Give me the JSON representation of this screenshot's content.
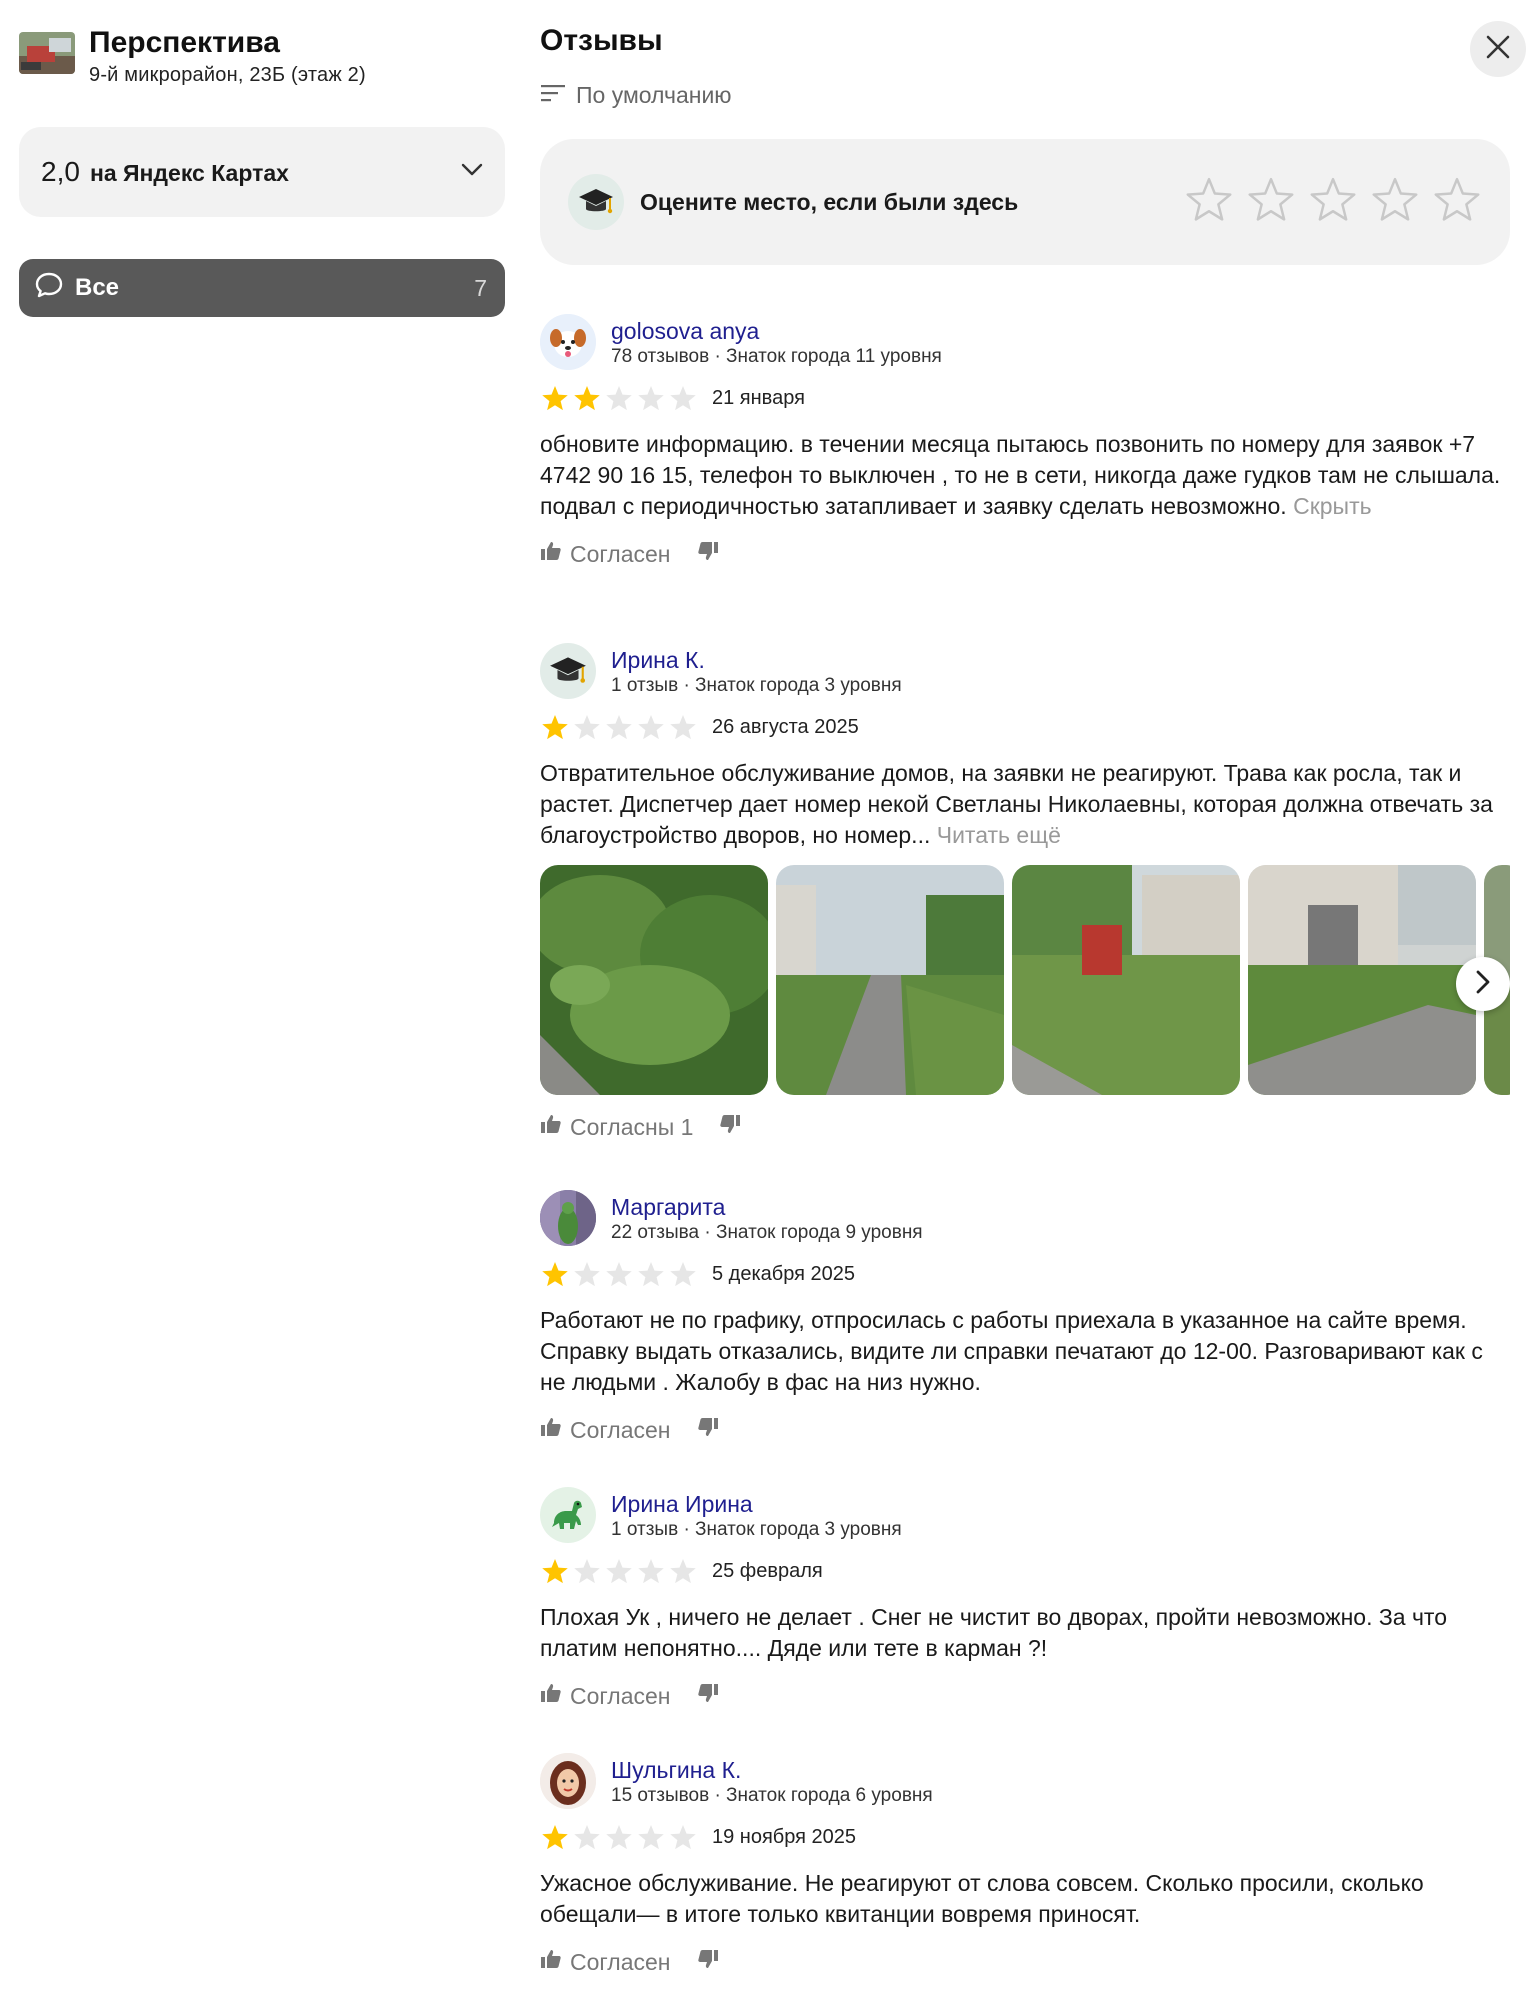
{
  "org": {
    "name": "Перспектива",
    "address": "9-й микрорайон, 23Б (этаж 2)"
  },
  "rating": {
    "value": "2,0",
    "source": "на Яндекс Картах"
  },
  "filter": {
    "label": "Все",
    "count": "7"
  },
  "main": {
    "title": "Отзывы",
    "sort_label": "По умолчанию",
    "rate_prompt": "Оцените место, если были здесь"
  },
  "reviews": [
    {
      "name": "golosova anya",
      "meta": "78 отзывов · Знаток города 11 уровня",
      "stars": 2,
      "date": "21 января",
      "text": "обновите информацию. в течении месяца пытаюсь позвонить по номеру для заявок +7 4742 90 16 15, телефон то выключен , то не в сети, никогда даже гудков там не слышала. подвал с периодичностью затапливает и заявку сделать невозможно.",
      "more": "Скрыть",
      "agree": "Согласен",
      "avatar": "dog-avatar"
    },
    {
      "name": "Ирина К.",
      "meta": "1 отзыв · Знаток города 3 уровня",
      "stars": 1,
      "date": "26 августа 2025",
      "text": "Отвратительное обслуживание домов, на заявки не реагируют. Трава как росла, так и растет. Диспетчер дает номер некой Светланы Николаевны, которая должна отвечать за благоустройство дворов, но номер...",
      "more": "Читать ещё",
      "agree": "Согласны 1",
      "avatar": "graduation-cap-avatar"
    },
    {
      "name": "Маргарита",
      "meta": "22 отзыва · Знаток города 9 уровня",
      "stars": 1,
      "date": "5 декабря 2025",
      "text": "Работают не по графику, отпросилась с работы приехала в указанное на сайте время. Справку выдать отказались, видите ли справки печатают до 12-00. Разговаривают как с не людьми . Жалобу в фас на низ нужно.",
      "more": "",
      "agree": "Согласен",
      "avatar": "photo-avatar"
    },
    {
      "name": "Ирина Ирина",
      "meta": "1 отзыв · Знаток города 3 уровня",
      "stars": 1,
      "date": "25 февраля",
      "text": "Плохая Ук , ничего не делает . Снег не чистит во дворах, пройти невозможно. За что платим непонятно.... Дяде или тете в карман ?!",
      "more": "",
      "agree": "Согласен",
      "avatar": "dinosaur-avatar"
    },
    {
      "name": "Шульгина К.",
      "meta": "15 отзывов · Знаток города 6 уровня",
      "stars": 1,
      "date": "19 ноября 2025",
      "text": "Ужасное обслуживание. Не реагируют от слова совсем. Сколько просили, сколько обещали— в итоге только квитанции вовремя приносят.",
      "more": "",
      "agree": "Согласен",
      "avatar": "woman-avatar"
    }
  ],
  "colors": {
    "star_filled": "#ffc400",
    "star_empty": "#e6e6e6",
    "link": "#1f1f8f",
    "filter_bg": "#595959"
  }
}
